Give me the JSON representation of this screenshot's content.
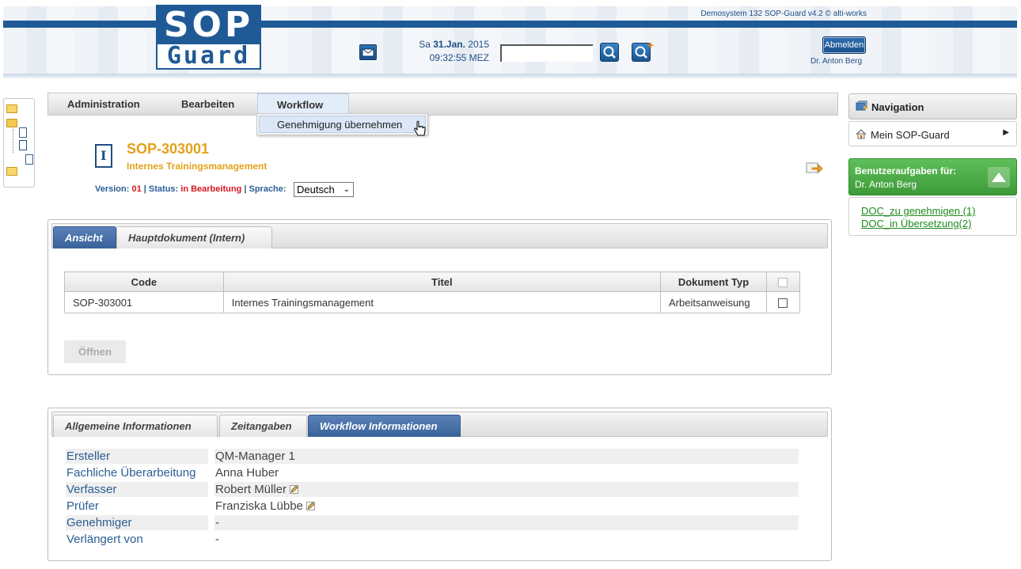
{
  "header": {
    "logo_top": "SOP",
    "logo_bottom": "Guard",
    "system_info": "Demosystem 132 SOP-Guard v4.2 © alti-works",
    "date_day": "Sa",
    "date_main": "31.Jan.",
    "date_year": "2015",
    "time": "09:32:55 MEZ",
    "search_value": "",
    "logout_label": "Abmelden",
    "user_name": "Dr. Anton Berg"
  },
  "menu": {
    "items": [
      "Administration",
      "Bearbeiten",
      "Workflow"
    ],
    "workflow_dropdown": [
      "Genehmigung übernehmen"
    ]
  },
  "document": {
    "code": "SOP-303001",
    "title": "Internes Trainingsmanagement",
    "version_label": "Version:",
    "version": "01",
    "status_label": "Status:",
    "status": "in Bearbeitung",
    "language_label": "Sprache:",
    "language": "Deutsch",
    "separator": "|"
  },
  "view_panel": {
    "tabs": [
      "Ansicht",
      "Hauptdokument (Intern)"
    ],
    "active_tab": "Ansicht",
    "columns": [
      "Code",
      "Titel",
      "Dokument Typ"
    ],
    "rows": [
      {
        "code": "SOP-303001",
        "titel": "Internes Trainingsmanagement",
        "typ": "Arbeitsanweisung"
      }
    ],
    "open_label": "Öffnen"
  },
  "info_panel": {
    "tabs": [
      "Allgemeine Informationen",
      "Zeitangaben",
      "Workflow Informationen"
    ],
    "active_tab": "Workflow Informationen",
    "rows": [
      {
        "label": "Ersteller",
        "value": "QM-Manager 1"
      },
      {
        "label": "Fachliche Überarbeitung",
        "value": "Anna Huber"
      },
      {
        "label": "Verfasser",
        "value": "Robert Müller"
      },
      {
        "label": "Prüfer",
        "value": "Franziska Lübbe"
      },
      {
        "label": "Genehmiger",
        "value": "-"
      },
      {
        "label": "Verlängert von",
        "value": "-"
      }
    ]
  },
  "sidebar": {
    "navigation_title": "Navigation",
    "nav_item": "Mein SOP-Guard",
    "tasks_title": "Benutzeraufgaben für:",
    "tasks_user": "Dr. Anton Berg",
    "task_links": [
      "DOC_zu genehmigen (1)",
      "DOC_in Übersetzung(2)"
    ]
  },
  "colors": {
    "brand_blue": "#1f5a96",
    "doc_orange": "#e3a21a",
    "status_red": "#d4171f",
    "task_green": "#3c9a38"
  },
  "icons": [
    "mail-icon",
    "search-icon",
    "search-add-icon",
    "document-icon",
    "export-icon",
    "navigation-icon",
    "home-icon",
    "pencil-icon",
    "folder-icon",
    "collapse-icon"
  ]
}
